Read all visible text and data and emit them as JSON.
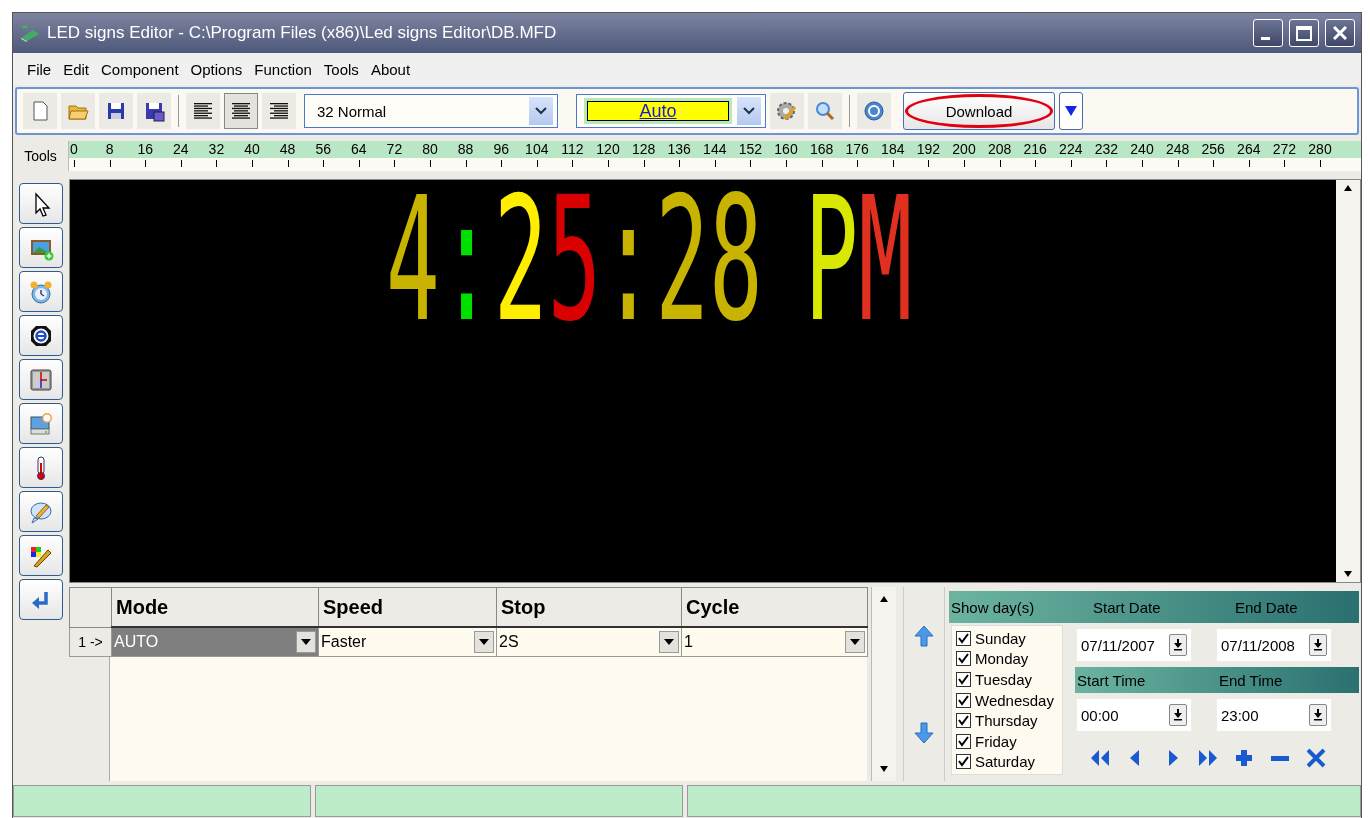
{
  "window": {
    "title": "LED signs Editor - C:\\Program Files (x86)\\Led signs Editor\\DB.MFD"
  },
  "menu": [
    "File",
    "Edit",
    "Component",
    "Options",
    "Function",
    "Tools",
    "About"
  ],
  "toolbar": {
    "alignment": [
      {
        "selected": false
      },
      {
        "selected": true
      },
      {
        "selected": false
      }
    ],
    "font_select": "32 Normal",
    "color_select": "Auto",
    "download": "Download",
    "download_highlighted": true
  },
  "ruler": {
    "label": "Tools",
    "ticks": [
      "0",
      "8",
      "16",
      "24",
      "32",
      "40",
      "48",
      "56",
      "64",
      "72",
      "80",
      "88",
      "96",
      "104",
      "112",
      "120",
      "128",
      "136",
      "144",
      "152",
      "160",
      "168",
      "176",
      "184",
      "192",
      "200",
      "208",
      "216",
      "224",
      "232",
      "240",
      "248",
      "256",
      "264",
      "272",
      "280"
    ]
  },
  "display": {
    "segments": [
      {
        "text": "4",
        "color": "#c8b400"
      },
      {
        "text": ":",
        "color": "#00e000"
      },
      {
        "text": "2",
        "color": "#ffee00"
      },
      {
        "text": "5",
        "color": "#d80000"
      },
      {
        "text": ":",
        "color": "#c8b400"
      },
      {
        "text": "28",
        "color": "#c8b400"
      },
      {
        "text": "P",
        "color": "#d8e800"
      },
      {
        "text": "M",
        "color": "#e03020"
      }
    ]
  },
  "grid": {
    "columns": [
      "Mode",
      "Speed",
      "Stop",
      "Cycle"
    ],
    "rows": [
      {
        "marker": "1 ->",
        "cells": [
          {
            "value": "AUTO",
            "selected": true
          },
          {
            "value": "Faster",
            "selected": false
          },
          {
            "value": "2S",
            "selected": false
          },
          {
            "value": "1",
            "selected": false
          }
        ]
      }
    ]
  },
  "schedule": {
    "days_label": "Show day(s)",
    "days": [
      {
        "label": "Sunday",
        "checked": true
      },
      {
        "label": "Monday",
        "checked": true
      },
      {
        "label": "Tuesday",
        "checked": true
      },
      {
        "label": "Wednesday",
        "checked": true
      },
      {
        "label": "Thursday",
        "checked": true
      },
      {
        "label": "Friday",
        "checked": true
      },
      {
        "label": "Saturday",
        "checked": true
      }
    ],
    "start_date_label": "Start Date",
    "start_date": "07/11/2007",
    "end_date_label": "End Date",
    "end_date": "07/11/2008",
    "start_time_label": "Start Time",
    "start_time": "00:00",
    "end_time_label": "End Time",
    "end_time": "23:00"
  }
}
